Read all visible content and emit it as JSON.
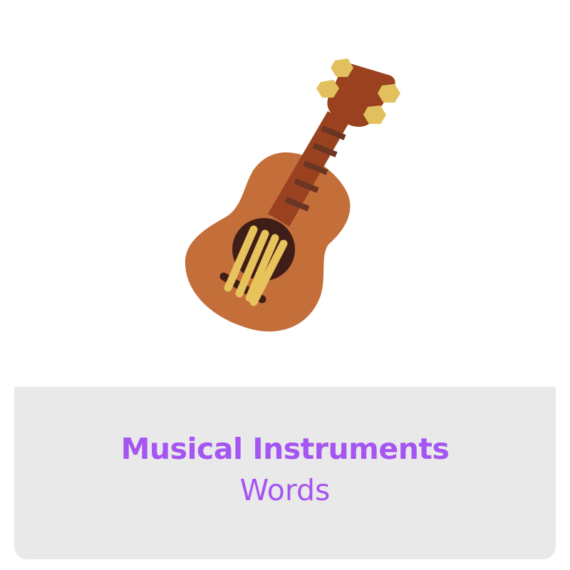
{
  "card": {
    "title": "Musical Instruments",
    "subtitle": "Words",
    "icon": "guitar-icon"
  },
  "colors": {
    "accent_text": "#a555f1",
    "panel_background": "#e9e9ea",
    "guitar_body": "#c46e39",
    "guitar_neck": "#9a4220",
    "sound_hole": "#3f1e17",
    "strings": "#e8c25a",
    "tuning_pegs": "#e2c05e",
    "frets": "#6b3524"
  }
}
